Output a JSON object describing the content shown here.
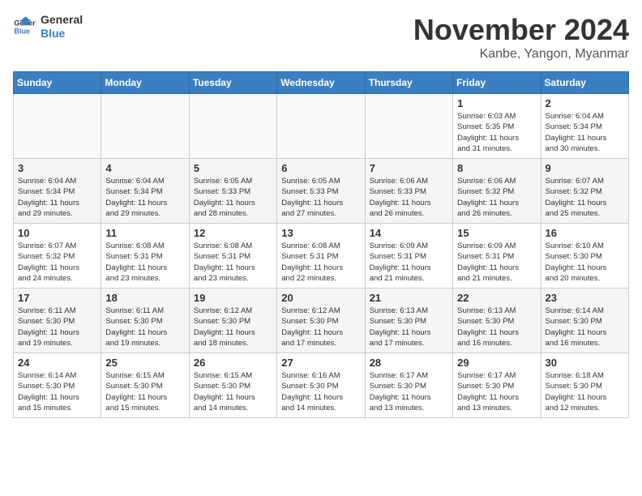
{
  "logo": {
    "line1": "General",
    "line2": "Blue"
  },
  "title": "November 2024",
  "location": "Kanbe, Yangon, Myanmar",
  "days_of_week": [
    "Sunday",
    "Monday",
    "Tuesday",
    "Wednesday",
    "Thursday",
    "Friday",
    "Saturday"
  ],
  "weeks": [
    [
      {
        "day": "",
        "info": ""
      },
      {
        "day": "",
        "info": ""
      },
      {
        "day": "",
        "info": ""
      },
      {
        "day": "",
        "info": ""
      },
      {
        "day": "",
        "info": ""
      },
      {
        "day": "1",
        "info": "Sunrise: 6:03 AM\nSunset: 5:35 PM\nDaylight: 11 hours\nand 31 minutes."
      },
      {
        "day": "2",
        "info": "Sunrise: 6:04 AM\nSunset: 5:34 PM\nDaylight: 11 hours\nand 30 minutes."
      }
    ],
    [
      {
        "day": "3",
        "info": "Sunrise: 6:04 AM\nSunset: 5:34 PM\nDaylight: 11 hours\nand 29 minutes."
      },
      {
        "day": "4",
        "info": "Sunrise: 6:04 AM\nSunset: 5:34 PM\nDaylight: 11 hours\nand 29 minutes."
      },
      {
        "day": "5",
        "info": "Sunrise: 6:05 AM\nSunset: 5:33 PM\nDaylight: 11 hours\nand 28 minutes."
      },
      {
        "day": "6",
        "info": "Sunrise: 6:05 AM\nSunset: 5:33 PM\nDaylight: 11 hours\nand 27 minutes."
      },
      {
        "day": "7",
        "info": "Sunrise: 6:06 AM\nSunset: 5:33 PM\nDaylight: 11 hours\nand 26 minutes."
      },
      {
        "day": "8",
        "info": "Sunrise: 6:06 AM\nSunset: 5:32 PM\nDaylight: 11 hours\nand 26 minutes."
      },
      {
        "day": "9",
        "info": "Sunrise: 6:07 AM\nSunset: 5:32 PM\nDaylight: 11 hours\nand 25 minutes."
      }
    ],
    [
      {
        "day": "10",
        "info": "Sunrise: 6:07 AM\nSunset: 5:32 PM\nDaylight: 11 hours\nand 24 minutes."
      },
      {
        "day": "11",
        "info": "Sunrise: 6:08 AM\nSunset: 5:31 PM\nDaylight: 11 hours\nand 23 minutes."
      },
      {
        "day": "12",
        "info": "Sunrise: 6:08 AM\nSunset: 5:31 PM\nDaylight: 11 hours\nand 23 minutes."
      },
      {
        "day": "13",
        "info": "Sunrise: 6:08 AM\nSunset: 5:31 PM\nDaylight: 11 hours\nand 22 minutes."
      },
      {
        "day": "14",
        "info": "Sunrise: 6:09 AM\nSunset: 5:31 PM\nDaylight: 11 hours\nand 21 minutes."
      },
      {
        "day": "15",
        "info": "Sunrise: 6:09 AM\nSunset: 5:31 PM\nDaylight: 11 hours\nand 21 minutes."
      },
      {
        "day": "16",
        "info": "Sunrise: 6:10 AM\nSunset: 5:30 PM\nDaylight: 11 hours\nand 20 minutes."
      }
    ],
    [
      {
        "day": "17",
        "info": "Sunrise: 6:11 AM\nSunset: 5:30 PM\nDaylight: 11 hours\nand 19 minutes."
      },
      {
        "day": "18",
        "info": "Sunrise: 6:11 AM\nSunset: 5:30 PM\nDaylight: 11 hours\nand 19 minutes."
      },
      {
        "day": "19",
        "info": "Sunrise: 6:12 AM\nSunset: 5:30 PM\nDaylight: 11 hours\nand 18 minutes."
      },
      {
        "day": "20",
        "info": "Sunrise: 6:12 AM\nSunset: 5:30 PM\nDaylight: 11 hours\nand 17 minutes."
      },
      {
        "day": "21",
        "info": "Sunrise: 6:13 AM\nSunset: 5:30 PM\nDaylight: 11 hours\nand 17 minutes."
      },
      {
        "day": "22",
        "info": "Sunrise: 6:13 AM\nSunset: 5:30 PM\nDaylight: 11 hours\nand 16 minutes."
      },
      {
        "day": "23",
        "info": "Sunrise: 6:14 AM\nSunset: 5:30 PM\nDaylight: 11 hours\nand 16 minutes."
      }
    ],
    [
      {
        "day": "24",
        "info": "Sunrise: 6:14 AM\nSunset: 5:30 PM\nDaylight: 11 hours\nand 15 minutes."
      },
      {
        "day": "25",
        "info": "Sunrise: 6:15 AM\nSunset: 5:30 PM\nDaylight: 11 hours\nand 15 minutes."
      },
      {
        "day": "26",
        "info": "Sunrise: 6:15 AM\nSunset: 5:30 PM\nDaylight: 11 hours\nand 14 minutes."
      },
      {
        "day": "27",
        "info": "Sunrise: 6:16 AM\nSunset: 5:30 PM\nDaylight: 11 hours\nand 14 minutes."
      },
      {
        "day": "28",
        "info": "Sunrise: 6:17 AM\nSunset: 5:30 PM\nDaylight: 11 hours\nand 13 minutes."
      },
      {
        "day": "29",
        "info": "Sunrise: 6:17 AM\nSunset: 5:30 PM\nDaylight: 11 hours\nand 13 minutes."
      },
      {
        "day": "30",
        "info": "Sunrise: 6:18 AM\nSunset: 5:30 PM\nDaylight: 11 hours\nand 12 minutes."
      }
    ]
  ]
}
